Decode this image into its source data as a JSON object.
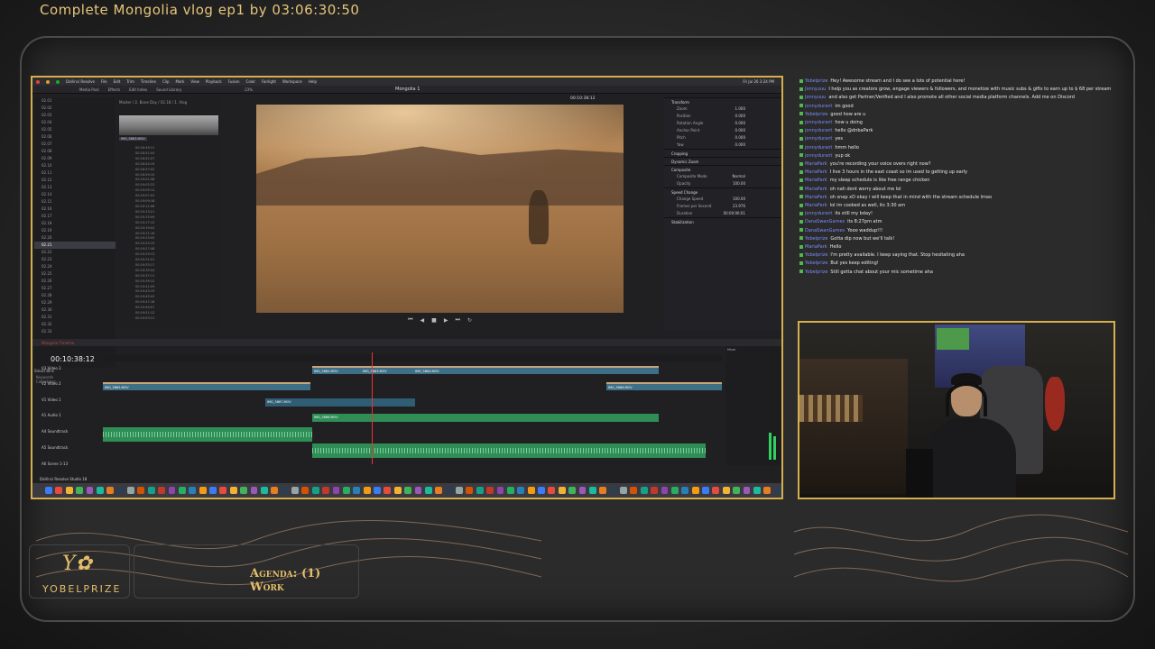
{
  "stream": {
    "title": "Complete Mongolia vlog ep1 by 03:06:30:50",
    "brand_name": "YOBELPRIZE",
    "agenda": "Agenda: (1) Work"
  },
  "editor": {
    "app_name": "DaVinci Resolve",
    "menu": [
      "File",
      "Edit",
      "Trim",
      "Timeline",
      "Clip",
      "Mark",
      "View",
      "Playback",
      "Fusion",
      "Color",
      "Fairlight",
      "Workspace",
      "Help"
    ],
    "clock": "Fri Jul 26 3:24 PM",
    "toolbar": [
      "Media Pool",
      "Effects",
      "Edit Index",
      "Sound Library"
    ],
    "project_title": "Mongolia 1",
    "timeline_name": "Mongolia Timeline",
    "viewer_timecode": "00:10:38:12",
    "timeline_timecode": "00:10:38:12",
    "zoom": "23%",
    "media_tree": [
      "02.01",
      "02.02",
      "02.03",
      "02.04",
      "02.05",
      "02.06",
      "02.07",
      "02.08",
      "02.09",
      "02.10",
      "02.11",
      "02.12",
      "02.13",
      "02.14",
      "02.15",
      "02.16",
      "02.17",
      "02.18",
      "02.19",
      "02.20",
      "02.21",
      "02.22",
      "02.23",
      "02.24",
      "02.25",
      "02.26",
      "02.27",
      "02.28",
      "02.29",
      "02.30",
      "02.31",
      "02.32",
      "02.33"
    ],
    "media_tree_selected_index": 20,
    "bins_label": "Smart Bins",
    "bins": [
      "Keywords",
      "Collections"
    ],
    "pool_header": "Master / 2. Bone Day / 02.18 / 1. Vlog",
    "thumb_label": "IMG_5863.MOV",
    "clip_rows": [
      "00:18:49:11",
      "00:18:51:04",
      "00:18:52:07",
      "00:18:54:19",
      "00:18:57:02",
      "00:18:59:15",
      "00:19:01:08",
      "00:19:03:22",
      "00:19:05:14",
      "00:19:07:03",
      "00:19:09:18",
      "00:19:11:06",
      "00:19:13:21",
      "00:19:15:09",
      "00:19:17:12",
      "00:19:19:02",
      "00:19:21:16",
      "00:19:23:05",
      "00:19:25:19",
      "00:19:27:08",
      "00:19:29:13",
      "00:19:31:01",
      "00:19:33:17",
      "00:19:35:04",
      "00:19:37:11",
      "00:19:39:22",
      "00:19:41:09",
      "00:19:43:15",
      "00:19:45:02",
      "00:19:47:18",
      "00:19:49:07",
      "00:19:51:12",
      "00:19:53:21"
    ],
    "inspector": {
      "sections": [
        "Transform",
        "Cropping",
        "Dynamic Zoom",
        "Composite",
        "Speed Change",
        "Stabilization"
      ],
      "rows": [
        [
          "Zoom",
          "1.000"
        ],
        [
          "Position",
          "0.000"
        ],
        [
          "Rotation Angle",
          "0.000"
        ],
        [
          "Anchor Point",
          "0.000"
        ],
        [
          "Pitch",
          "0.000"
        ],
        [
          "Yaw",
          "0.000"
        ],
        [
          "Composite Mode",
          "Normal"
        ],
        [
          "Opacity",
          "100.00"
        ],
        [
          "Change Speed",
          "100.00"
        ],
        [
          "Frames per Second",
          "23.976"
        ],
        [
          "Duration",
          "00:00:06:01"
        ]
      ]
    },
    "tracks": [
      {
        "name": "Video 3",
        "id": "V3"
      },
      {
        "name": "Video 2",
        "id": "V2"
      },
      {
        "name": "Video 1",
        "id": "V1"
      },
      {
        "name": "Audio 1",
        "id": "A1"
      },
      {
        "name": "Soundtrack",
        "id": "A4"
      },
      {
        "name": "Soundtrack",
        "id": "A5"
      },
      {
        "name": "Scene 1-13",
        "id": "A6"
      }
    ],
    "clips": [
      "IMG_5862.MOV",
      "IMG_5863.MOV",
      "IMG_5864.MOV",
      "IMG_5865.MOV",
      "IMG_5866.MOV",
      "IMG_5867.MOV",
      "IMG_5868.MOV"
    ],
    "mixer_label": "Mixer",
    "resolve_version": "DaVinci Resolve Studio 18"
  },
  "chat": [
    {
      "user": "Yobelprize",
      "text": "Hey! Awesome stream and I do see a lots of potential here!"
    },
    {
      "user": "Jonnyuuu",
      "text": "I help you as creators grow, engage viewers & followers, and monetize with music subs & gifts to earn up to $ 68 per stream"
    },
    {
      "user": "Jonnyuuu",
      "text": "and also get Partner/Verified and I also promote all other social media platform channels. Add me on Discord"
    },
    {
      "user": "jonnydurant",
      "text": "im good"
    },
    {
      "user": "Yobelprize",
      "text": "good how are u"
    },
    {
      "user": "jonnydurant",
      "text": "how u doing"
    },
    {
      "user": "jonnydurant",
      "text": "hello @dnbaPark"
    },
    {
      "user": "jonnydurant",
      "text": "yes"
    },
    {
      "user": "jonnydurant",
      "text": "hmm hello"
    },
    {
      "user": "jonnydurant",
      "text": "yup ok"
    },
    {
      "user": "MariaPark",
      "text": "you're recording your voice overs right now?"
    },
    {
      "user": "MariaPark",
      "text": "I live 3 hours in the east coast so im used to getting up early"
    },
    {
      "user": "MariaPark",
      "text": "my sleep schedule is like free range chicken"
    },
    {
      "user": "MariaPark",
      "text": "oh nah dont worry about me lol"
    },
    {
      "user": "MariaPark",
      "text": "oh snap xD okay i will keep that in mind with the stream schedule lmao"
    },
    {
      "user": "MariaPark",
      "text": "lol im cooked as well, its 3:30 am"
    },
    {
      "user": "jonnydurant",
      "text": "its still my bday!"
    },
    {
      "user": "DanaSwanGames",
      "text": "its 8:27pm atm"
    },
    {
      "user": "DanaSwanGames",
      "text": "Yooo waddup!!!"
    },
    {
      "user": "Yobelprize",
      "text": "Gotta dip now but we'll talk!"
    },
    {
      "user": "MariaPark",
      "text": "Hello"
    },
    {
      "user": "Yobelprize",
      "text": "I'm pretty available. I keep saying that. Stop hesitating aha"
    },
    {
      "user": "Yobelprize",
      "text": "But yes keep editing!"
    },
    {
      "user": "Yobelprize",
      "text": "Still gotta chat about your mic sometime aha"
    }
  ],
  "colors": {
    "accent_gold": "#d6ae4e",
    "chat_user": "#7c8cff",
    "audio_clip": "#2f8d56",
    "video_clip": "#3f6f86"
  }
}
